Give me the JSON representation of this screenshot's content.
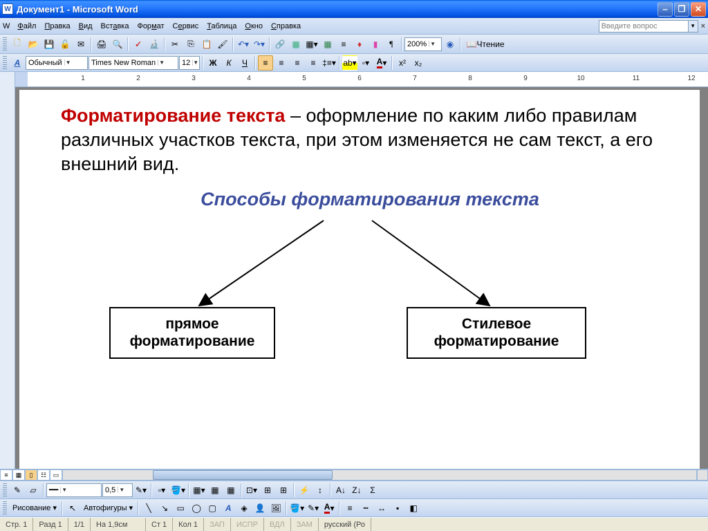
{
  "title": "Документ1 - Microsoft Word",
  "menu": {
    "file": "Файл",
    "edit": "Правка",
    "view": "Вид",
    "insert": "Вставка",
    "format": "Формат",
    "tools": "Сервис",
    "table": "Таблица",
    "window": "Окно",
    "help": "Справка"
  },
  "helpbox_placeholder": "Введите вопрос",
  "toolbar1": {
    "zoom": "200%",
    "read": "Чтение"
  },
  "toolbar2": {
    "style_label": "",
    "style": "Обычный",
    "font": "Times New Roman",
    "size": "12"
  },
  "format_icons": {
    "bold": "Ж",
    "italic": "К",
    "underline": "Ч"
  },
  "ruler_numbers": [
    "1",
    "2",
    "3",
    "4",
    "5",
    "6",
    "7",
    "8",
    "9",
    "10",
    "11",
    "12"
  ],
  "document": {
    "heading": "Форматирование текста",
    "dash": " – ",
    "body": "оформление по каким либо правилам различных участков текста, при этом изменяется не сам текст, а его внешний вид.",
    "subheading": "Способы форматирования текста",
    "box_left": "прямое форматирование",
    "box_right": "Стилевое форматирование"
  },
  "drawing": {
    "linewidth": "0,5",
    "label": "Рисование",
    "autofigures": "Автофигуры"
  },
  "status": {
    "page": "Стр. 1",
    "section": "Разд 1",
    "pages": "1/1",
    "at": "На 1,9см",
    "line": "Ст 1",
    "col": "Кол 1",
    "rec": "ЗАП",
    "trk": "ИСПР",
    "ext": "ВДЛ",
    "ovr": "ЗАМ",
    "lang": "русский (Ро"
  }
}
